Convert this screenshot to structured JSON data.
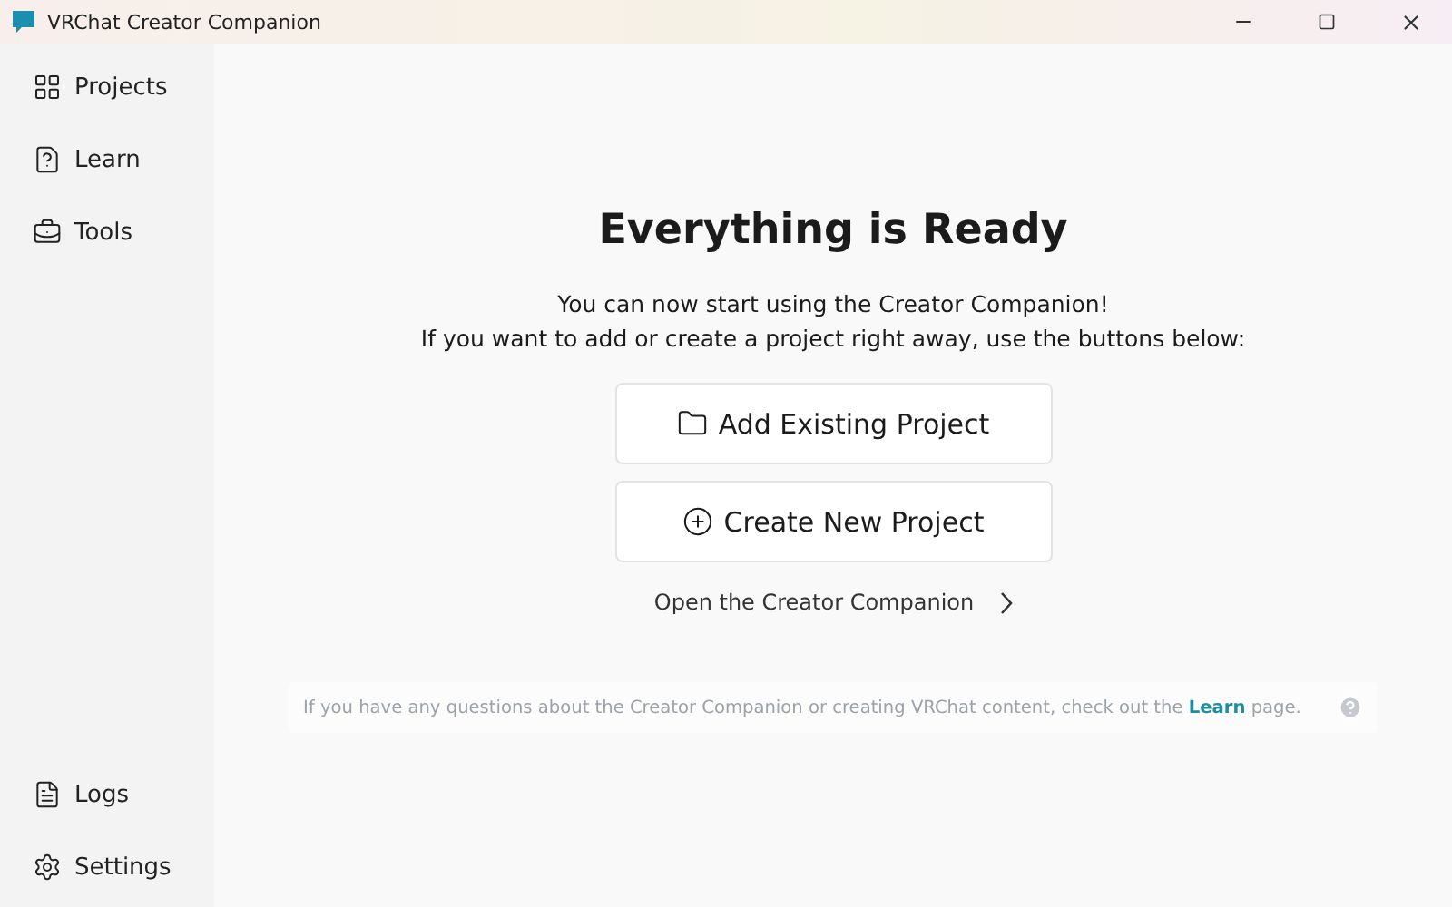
{
  "window": {
    "title": "VRChat Creator Companion"
  },
  "sidebar": {
    "top_items": [
      {
        "label": "Projects"
      },
      {
        "label": "Learn"
      },
      {
        "label": "Tools"
      }
    ],
    "bottom_items": [
      {
        "label": "Logs"
      },
      {
        "label": "Settings"
      }
    ]
  },
  "main": {
    "heading": "Everything is Ready",
    "intro_lines": [
      "You can now start using the Creator Companion!",
      "If you want to add or create a project right away, use the buttons below:"
    ],
    "buttons": [
      {
        "label": "Add Existing Project",
        "kind": "folder"
      },
      {
        "label": "Create New Project",
        "kind": "plus"
      }
    ],
    "open_link": "Open the Creator Companion",
    "help": {
      "text_before": "If you have any questions about the Creator Companion or creating VRChat content, check out the",
      "link": "Learn",
      "text_after": "page."
    }
  }
}
